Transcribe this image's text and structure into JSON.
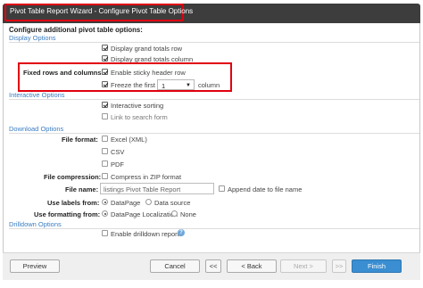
{
  "window": {
    "title": "Pivot Table Report Wizard - Configure Pivot Table Options"
  },
  "page": {
    "heading": "Configure additional pivot table options:"
  },
  "display_options": {
    "section_title": "Display Options",
    "grand_totals_row": "Display grand totals row",
    "grand_totals_column": "Display grand totals column",
    "fixed_label": "Fixed rows and columns:",
    "sticky_header": "Enable sticky header row",
    "freeze_first": "Freeze the first",
    "freeze_value": "1",
    "freeze_unit": "column"
  },
  "interactive_options": {
    "section_title": "Interactive Options",
    "sorting": "Interactive sorting",
    "search_link": "Link to search form"
  },
  "download_options": {
    "section_title": "Download Options",
    "file_format_label": "File format:",
    "formats": [
      "Excel (XML)",
      "CSV",
      "PDF"
    ],
    "compression_label": "File compression:",
    "compression_option": "Compress in ZIP format",
    "file_name_label": "File name:",
    "file_name_value": "listings Pivot Table Report",
    "append_date": "Append date to file name",
    "labels_from_label": "Use labels from:",
    "labels_from_options": [
      "DataPage",
      "Data source"
    ],
    "formatting_from_label": "Use formatting from:",
    "formatting_from_options": [
      "DataPage Localization",
      "None"
    ]
  },
  "drilldown_options": {
    "section_title": "Drilldown Options",
    "enable": "Enable drilldown reports"
  },
  "footer": {
    "preview": "Preview",
    "cancel": "Cancel",
    "first": "<<",
    "back": "< Back",
    "next": "Next >",
    "last": ">>",
    "finish": "Finish"
  },
  "colors": {
    "title_bar": "#3d3d3d",
    "highlight": "#e1000f",
    "section": "#3a7dc2",
    "primary": "#3a8ed1"
  }
}
